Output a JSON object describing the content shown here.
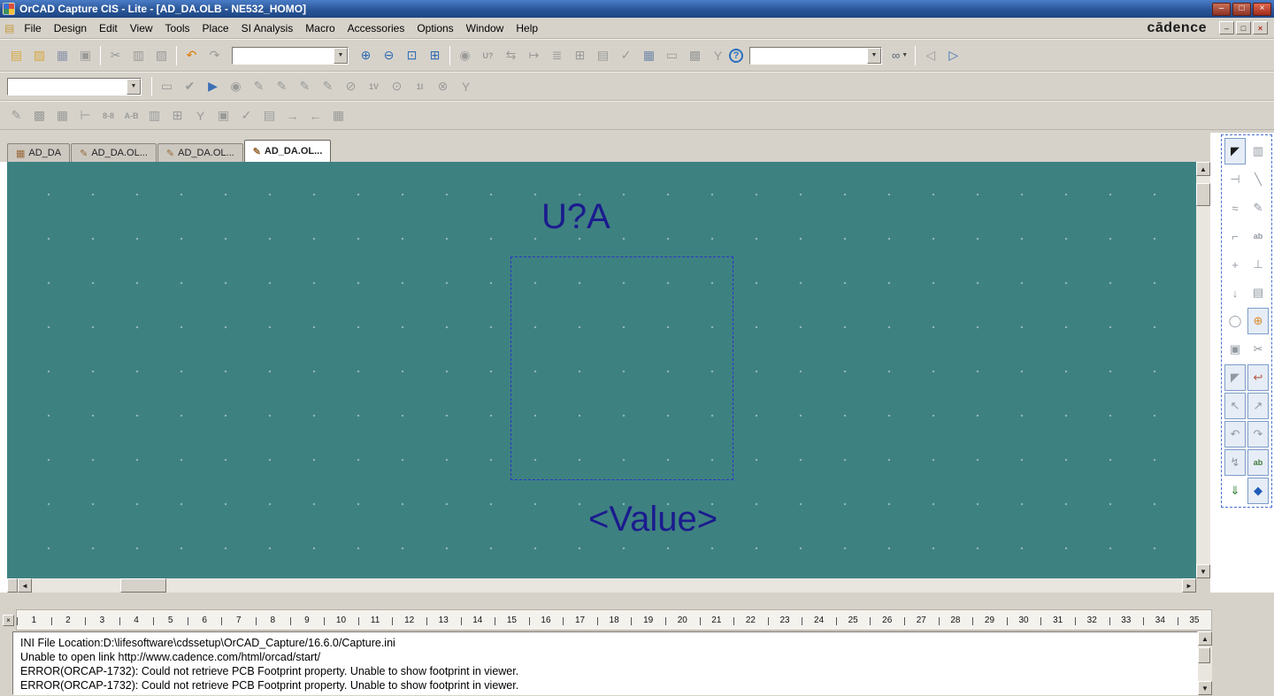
{
  "colors": {
    "canvas_bg": "#3e8181",
    "canvas_ink": "#1b1b8e",
    "selection": "#2a35c8"
  },
  "ui": {
    "dropdown": "▼"
  },
  "scrollbars": {
    "up": "▲",
    "down": "▼",
    "left": "◄",
    "right": "►"
  },
  "window": {
    "title": "OrCAD Capture CIS - Lite - [AD_DA.OLB - NE532_HOMO]",
    "controls": [
      {
        "name": "minimize-button",
        "glyph": "–"
      },
      {
        "name": "restore-button",
        "glyph": "□"
      },
      {
        "name": "close-button",
        "glyph": "×",
        "cls": "close"
      }
    ]
  },
  "menu": {
    "doc_icon": "▤",
    "items": [
      {
        "name": "menu-file",
        "label": "File"
      },
      {
        "name": "menu-design",
        "label": "Design"
      },
      {
        "name": "menu-edit",
        "label": "Edit"
      },
      {
        "name": "menu-view",
        "label": "View"
      },
      {
        "name": "menu-tools",
        "label": "Tools"
      },
      {
        "name": "menu-place",
        "label": "Place"
      },
      {
        "name": "menu-si-analysis",
        "label": "SI Analysis"
      },
      {
        "name": "menu-macro",
        "label": "Macro"
      },
      {
        "name": "menu-accessories",
        "label": "Accessories"
      },
      {
        "name": "menu-options",
        "label": "Options"
      },
      {
        "name": "menu-window",
        "label": "Window"
      },
      {
        "name": "menu-help",
        "label": "Help"
      }
    ],
    "brand": "cādence",
    "mdi_controls": [
      {
        "name": "mdi-minimize-button",
        "glyph": "–"
      },
      {
        "name": "mdi-restore-button",
        "glyph": "□"
      },
      {
        "name": "mdi-close-button",
        "glyph": "×",
        "cls": "red"
      }
    ]
  },
  "toolbar_main": {
    "file_group": [
      {
        "name": "new-document-icon",
        "glyph": "▤",
        "color": "#d9a93f"
      },
      {
        "name": "open-document-icon",
        "glyph": "▨",
        "color": "#d9a93f"
      },
      {
        "name": "save-document-icon",
        "glyph": "▦",
        "color": "#8a93a8"
      },
      {
        "name": "print-icon",
        "glyph": "▣"
      }
    ],
    "edit_group": [
      {
        "name": "cut-icon",
        "glyph": "✂"
      },
      {
        "name": "copy-icon",
        "glyph": "▥"
      },
      {
        "name": "paste-icon",
        "glyph": "▧"
      }
    ],
    "undo_group": [
      {
        "name": "undo-icon",
        "glyph": "↶",
        "color": "#e07b00"
      },
      {
        "name": "redo-icon",
        "glyph": "↷"
      }
    ],
    "combo1_value": "",
    "zoom_group": [
      {
        "name": "zoom-in-icon",
        "glyph": "⊕",
        "color": "#2f6bb3"
      },
      {
        "name": "zoom-out-icon",
        "glyph": "⊖",
        "color": "#2f6bb3"
      },
      {
        "name": "zoom-area-icon",
        "glyph": "⊡",
        "color": "#2f6bb3"
      },
      {
        "name": "zoom-all-icon",
        "glyph": "⊞",
        "color": "#2f6bb3"
      }
    ],
    "tools_group": [
      {
        "name": "fisheye-view-icon",
        "glyph": "◉"
      },
      {
        "name": "annotate-icon",
        "glyph": "U?",
        "cls": "txt"
      },
      {
        "name": "back-annotate-icon",
        "glyph": "⇆"
      },
      {
        "name": "update-properties-icon",
        "glyph": "↦"
      },
      {
        "name": "netlist-icon",
        "glyph": "≣"
      },
      {
        "name": "cross-reference-icon",
        "glyph": "⊞"
      },
      {
        "name": "bom-icon",
        "glyph": "▤"
      },
      {
        "name": "drc-icon",
        "glyph": "✓"
      },
      {
        "name": "snap-to-grid-icon",
        "glyph": "▦",
        "color": "#7188a8"
      },
      {
        "name": "area-select-icon",
        "glyph": "▭"
      },
      {
        "name": "project-manager-icon",
        "glyph": "▩"
      },
      {
        "name": "probe-icon",
        "glyph": "Y"
      }
    ],
    "combo2_value": "",
    "find_glyph": "∞",
    "nav_group": [
      {
        "name": "previous-page-icon",
        "glyph": "◁"
      },
      {
        "name": "next-page-icon",
        "glyph": "▷",
        "color": "#3a6fb5"
      }
    ]
  },
  "toolbar_si": {
    "combo_value": "",
    "icons": [
      {
        "name": "si-board-icon",
        "glyph": "▭"
      },
      {
        "name": "si-audit-icon",
        "glyph": "✔"
      },
      {
        "name": "si-run-icon",
        "glyph": "▶",
        "color": "#3a6fb5"
      },
      {
        "name": "si-halt-icon",
        "glyph": "◉"
      },
      {
        "name": "probe-voltage-icon",
        "glyph": "✎"
      },
      {
        "name": "probe-current-icon",
        "glyph": "✎"
      },
      {
        "name": "probe-power-icon",
        "glyph": "✎"
      },
      {
        "name": "probe-noise-icon",
        "glyph": "✎"
      },
      {
        "name": "si-impedance-icon",
        "glyph": "⊘"
      },
      {
        "name": "si-voltage-level-icon",
        "glyph": "1V",
        "cls": "txt"
      },
      {
        "name": "si-info-icon",
        "glyph": "⊙"
      },
      {
        "name": "si-current-level-icon",
        "glyph": "1I",
        "cls": "txt"
      },
      {
        "name": "si-power-level-icon",
        "glyph": "⊗"
      },
      {
        "name": "si-net-tree-icon",
        "glyph": "Y"
      }
    ]
  },
  "toolbar_lib": {
    "icons": [
      {
        "name": "edit-part-icon",
        "glyph": "✎"
      },
      {
        "name": "package-view-icon",
        "glyph": "▩"
      },
      {
        "name": "part-save-icon",
        "glyph": "▦"
      },
      {
        "name": "pin-edit-icon",
        "glyph": "⊢"
      },
      {
        "name": "pin-numbers-icon",
        "glyph": "8-8",
        "cls": "txt"
      },
      {
        "name": "pin-names-icon",
        "glyph": "A-B",
        "cls": "txt"
      },
      {
        "name": "package-copy-icon",
        "glyph": "▥"
      },
      {
        "name": "part-add-icon",
        "glyph": "⊞"
      },
      {
        "name": "filter-icon",
        "glyph": "Y"
      },
      {
        "name": "duplicate-part-icon",
        "glyph": "▣"
      },
      {
        "name": "validate-part-icon",
        "glyph": "✓"
      },
      {
        "name": "properties-icon",
        "glyph": "▤"
      },
      {
        "name": "export-part-icon",
        "glyph": "→"
      },
      {
        "name": "import-part-icon",
        "glyph": "←"
      },
      {
        "name": "spreadsheet-icon",
        "glyph": "▦"
      }
    ]
  },
  "tabs": [
    {
      "name": "tab-ad-da",
      "icon": "▦",
      "label": "AD_DA"
    },
    {
      "name": "tab-ad-da-olb-1",
      "icon": "✎",
      "label": "AD_DA.OL..."
    },
    {
      "name": "tab-ad-da-olb-2",
      "icon": "✎",
      "label": "AD_DA.OL..."
    },
    {
      "name": "tab-ad-da-olb-3",
      "icon": "✎",
      "label": "AD_DA.OL...",
      "cls": "active"
    }
  ],
  "canvas": {
    "part_reference": "U?A",
    "part_value": "<Value>"
  },
  "palette": {
    "tools": [
      {
        "name": "select-pointer-tool",
        "glyph": "◤",
        "cls": "framed dark"
      },
      {
        "name": "place-part-tool",
        "glyph": "▥"
      },
      {
        "name": "place-pin-tool",
        "glyph": "⊣"
      },
      {
        "name": "draw-line-tool",
        "glyph": "╲"
      },
      {
        "name": "draw-spline-tool",
        "glyph": "≈"
      },
      {
        "name": "draw-pen-tool",
        "glyph": "✎"
      },
      {
        "name": "draw-elbow-tool",
        "glyph": "⌐"
      },
      {
        "name": "place-text-tool",
        "glyph": "ab",
        "cls": "txt"
      },
      {
        "name": "move-tool",
        "glyph": "+"
      },
      {
        "name": "place-pin-array-tool",
        "glyph": "⊥"
      },
      {
        "name": "arrow-down-tool",
        "glyph": "↓"
      },
      {
        "name": "dock-panel-tool",
        "glyph": "▤"
      },
      {
        "name": "draw-ellipse-tool",
        "glyph": "◯"
      },
      {
        "name": "add-part-tool",
        "glyph": "⊕",
        "color": "#d9892a",
        "cls": "framed"
      },
      {
        "name": "copy-region-tool",
        "glyph": "▣"
      },
      {
        "name": "cut-tool",
        "glyph": "✂"
      },
      {
        "name": "select-frame-tool",
        "glyph": "◤",
        "cls": "framed"
      },
      {
        "name": "flip-tool",
        "glyph": "↩",
        "color": "#b5553f",
        "cls": "framed"
      },
      {
        "name": "drag-select-tool",
        "glyph": "↖",
        "cls": "framed"
      },
      {
        "name": "copy-drag-tool",
        "glyph": "↗",
        "cls": "framed"
      },
      {
        "name": "rotate-ccw-tool",
        "glyph": "↶",
        "cls": "framed"
      },
      {
        "name": "rotate-cw-tool",
        "glyph": "↷",
        "cls": "framed"
      },
      {
        "name": "zigzag-wire-tool",
        "glyph": "↯",
        "cls": "framed"
      },
      {
        "name": "add-text-tool",
        "glyph": "ab",
        "color": "#3f7a3f",
        "cls": "framed txt"
      },
      {
        "name": "export-symbol-tool",
        "glyph": "⇓",
        "color": "#2e7d32"
      },
      {
        "name": "add-symbol-tool",
        "glyph": "◆",
        "color": "#1e5bb8",
        "cls": "framed"
      }
    ]
  },
  "ruler": {
    "ticks": [
      "1",
      "2",
      "3",
      "4",
      "5",
      "6",
      "7",
      "8",
      "9",
      "10",
      "11",
      "12",
      "13",
      "14",
      "15",
      "16",
      "17",
      "18",
      "19",
      "20",
      "21",
      "22",
      "23",
      "24",
      "25",
      "26",
      "27",
      "28",
      "29",
      "30",
      "31",
      "32",
      "33",
      "34",
      "35"
    ]
  },
  "log": {
    "close_glyph": "×",
    "lines": [
      "INI File Location:D:\\lifesoftware\\cdssetup\\OrCAD_Capture/16.6.0/Capture.ini",
      "Unable to open link http://www.cadence.com/html/orcad/start/",
      "ERROR(ORCAP-1732): Could not retrieve PCB Footprint property. Unable to show footprint in viewer.",
      "ERROR(ORCAP-1732): Could not retrieve PCB Footprint property. Unable to show footprint in viewer."
    ]
  }
}
